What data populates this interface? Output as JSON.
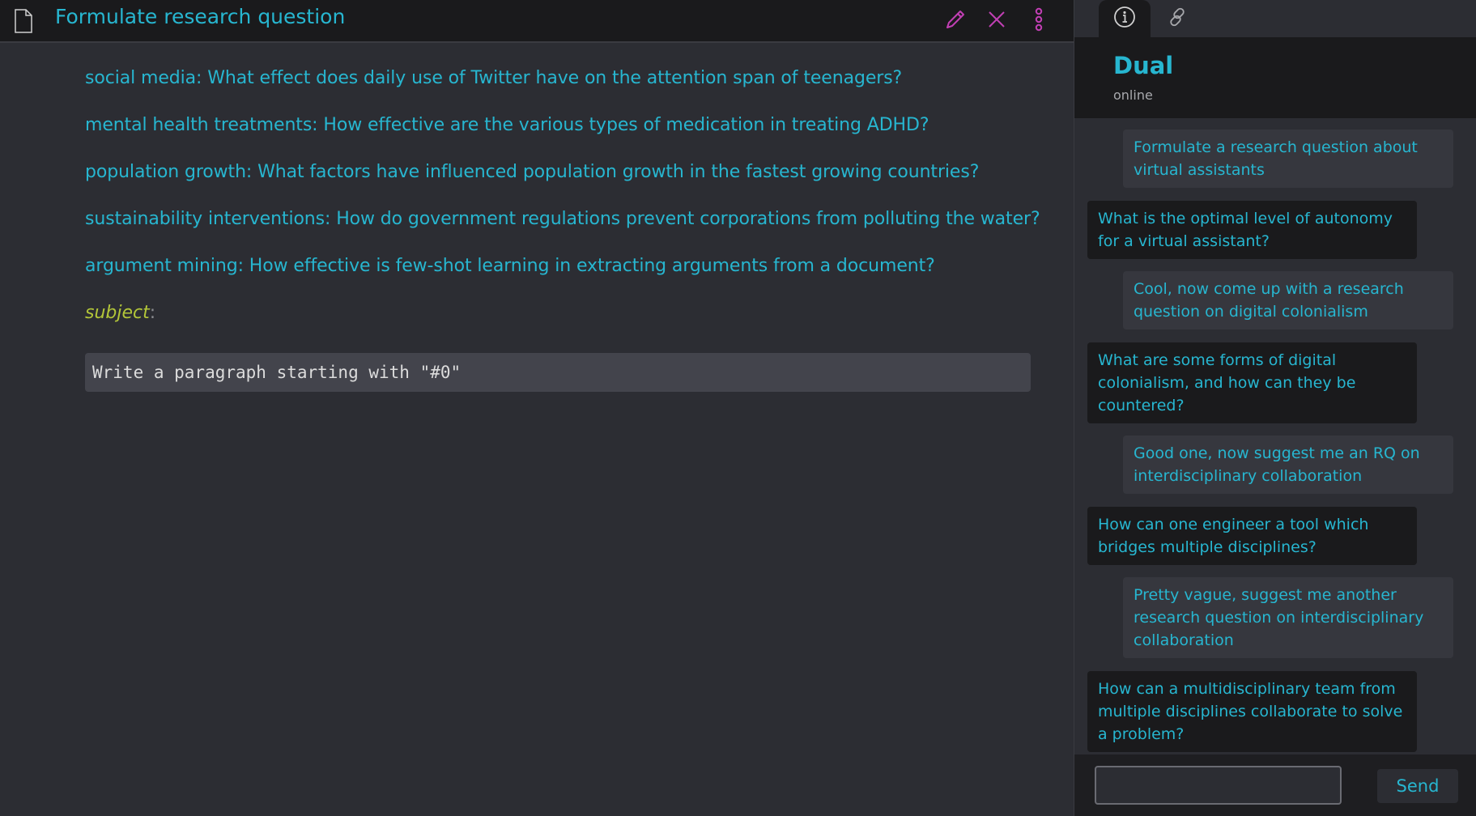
{
  "document": {
    "title": "Formulate research question",
    "icons": {
      "file": "file-icon",
      "edit": "pencil-icon",
      "close": "close-icon",
      "more": "more-vertical-icon"
    },
    "questions": [
      "social media: What effect does daily use of Twitter have on the attention span of teenagers?",
      "mental health treatments: How effective are the various types of medication in treating ADHD?",
      "population growth: What factors have influenced population growth in the fastest growing countries?",
      "sustainability interventions: How do government regulations prevent corporations from polluting the water?",
      "argument mining: How effective is few-shot learning in extracting arguments from a document?"
    ],
    "subject_label": "subject",
    "subject_colon": ":",
    "prompt": "Write a paragraph starting with \"#0\""
  },
  "chat": {
    "tabs": [
      {
        "name": "info",
        "icon": "info-icon"
      },
      {
        "name": "links",
        "icon": "link-icon"
      }
    ],
    "agent_name": "Dual",
    "agent_status": "online",
    "messages": [
      {
        "role": "user",
        "text": "Formulate a research question about virtual assistants"
      },
      {
        "role": "agent",
        "text": "What is the optimal level of autonomy for a virtual assistant?"
      },
      {
        "role": "user",
        "text": "Cool, now come up with a research question on digital colonialism"
      },
      {
        "role": "agent",
        "text": "What are some forms of digital colonialism, and how can they be countered?"
      },
      {
        "role": "user",
        "text": "Good one, now suggest me an RQ on interdisciplinary collaboration"
      },
      {
        "role": "agent",
        "text": "How can one engineer a tool which bridges multiple disciplines?"
      },
      {
        "role": "user",
        "text": "Pretty vague, suggest me another research question on interdisciplinary collaboration"
      },
      {
        "role": "agent",
        "text": "How can a multidisciplinary team from multiple disciplines collaborate to solve a problem?"
      }
    ],
    "input": {
      "value": "",
      "placeholder": ""
    },
    "send_label": "Send"
  },
  "colors": {
    "accent": "#27b6d0",
    "subject": "#b3c639",
    "action_icons": "#c23fb4",
    "background": "#2c2d33",
    "header": "#1a1a1c"
  }
}
